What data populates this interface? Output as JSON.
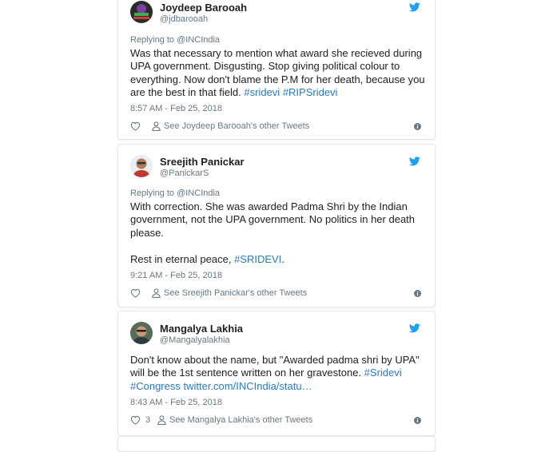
{
  "tweets": [
    {
      "name": "Joydeep Barooah",
      "handle": "@jdbarooah",
      "reply": "Replying to @INCIndia",
      "text_lines": [
        "Was that necessary to mention what award she recieved during",
        "UPA government. Disgusting. Stop giving political colour to",
        "everything. Now don't blame the P.M for her death, because you",
        "are the best in that field."
      ],
      "hashtags": [
        "#sridevi",
        "#RIPSridevi"
      ],
      "time": "8:57 AM - Feb 25, 2018",
      "likes": "",
      "see_link": "See Joydeep Barooah's other Tweets",
      "avatar_icon": "profile-photo"
    },
    {
      "name": "Sreejith Panickar",
      "handle": "@PanickarS",
      "reply": "Replying to @INCIndia",
      "text_lines": [
        "With correction. She was awarded Padma Shri by the Indian",
        "government, not the UPA government. No politics in her death",
        "please."
      ],
      "text2_prefix": "Rest in eternal peace, ",
      "text2_hashtag": "#SRIDEVI",
      "text2_suffix": ".",
      "time": "9:21 AM - Feb 25, 2018",
      "likes": "",
      "see_link": "See Sreejith Panickar's other Tweets",
      "avatar_icon": "profile-photo"
    },
    {
      "name": "Mangalya Lakhia",
      "handle": "@Mangalyalakhia",
      "text_lines": [
        "Don't know about the name, but \"Awarded padma shri by UPA\""
      ],
      "line2_prefix": "will be the 1st sentence written on her gravestone. ",
      "line2_hashtag": "#Sridevi",
      "line3": "#Congress twitter.com/INCIndia/statu…",
      "time": "8:43 AM - Feb 25, 2018",
      "likes": "3",
      "see_link": "See Mangalya Lakhia's other Tweets",
      "avatar_icon": "profile-photo"
    }
  ],
  "colors": {
    "link": "#2b7bb9",
    "twitter_blue": "#1da1f2",
    "muted": "#697882",
    "border": "#e1e8ed"
  },
  "icons": [
    "twitter-bird-icon",
    "heart-icon",
    "person-icon",
    "info-icon"
  ]
}
